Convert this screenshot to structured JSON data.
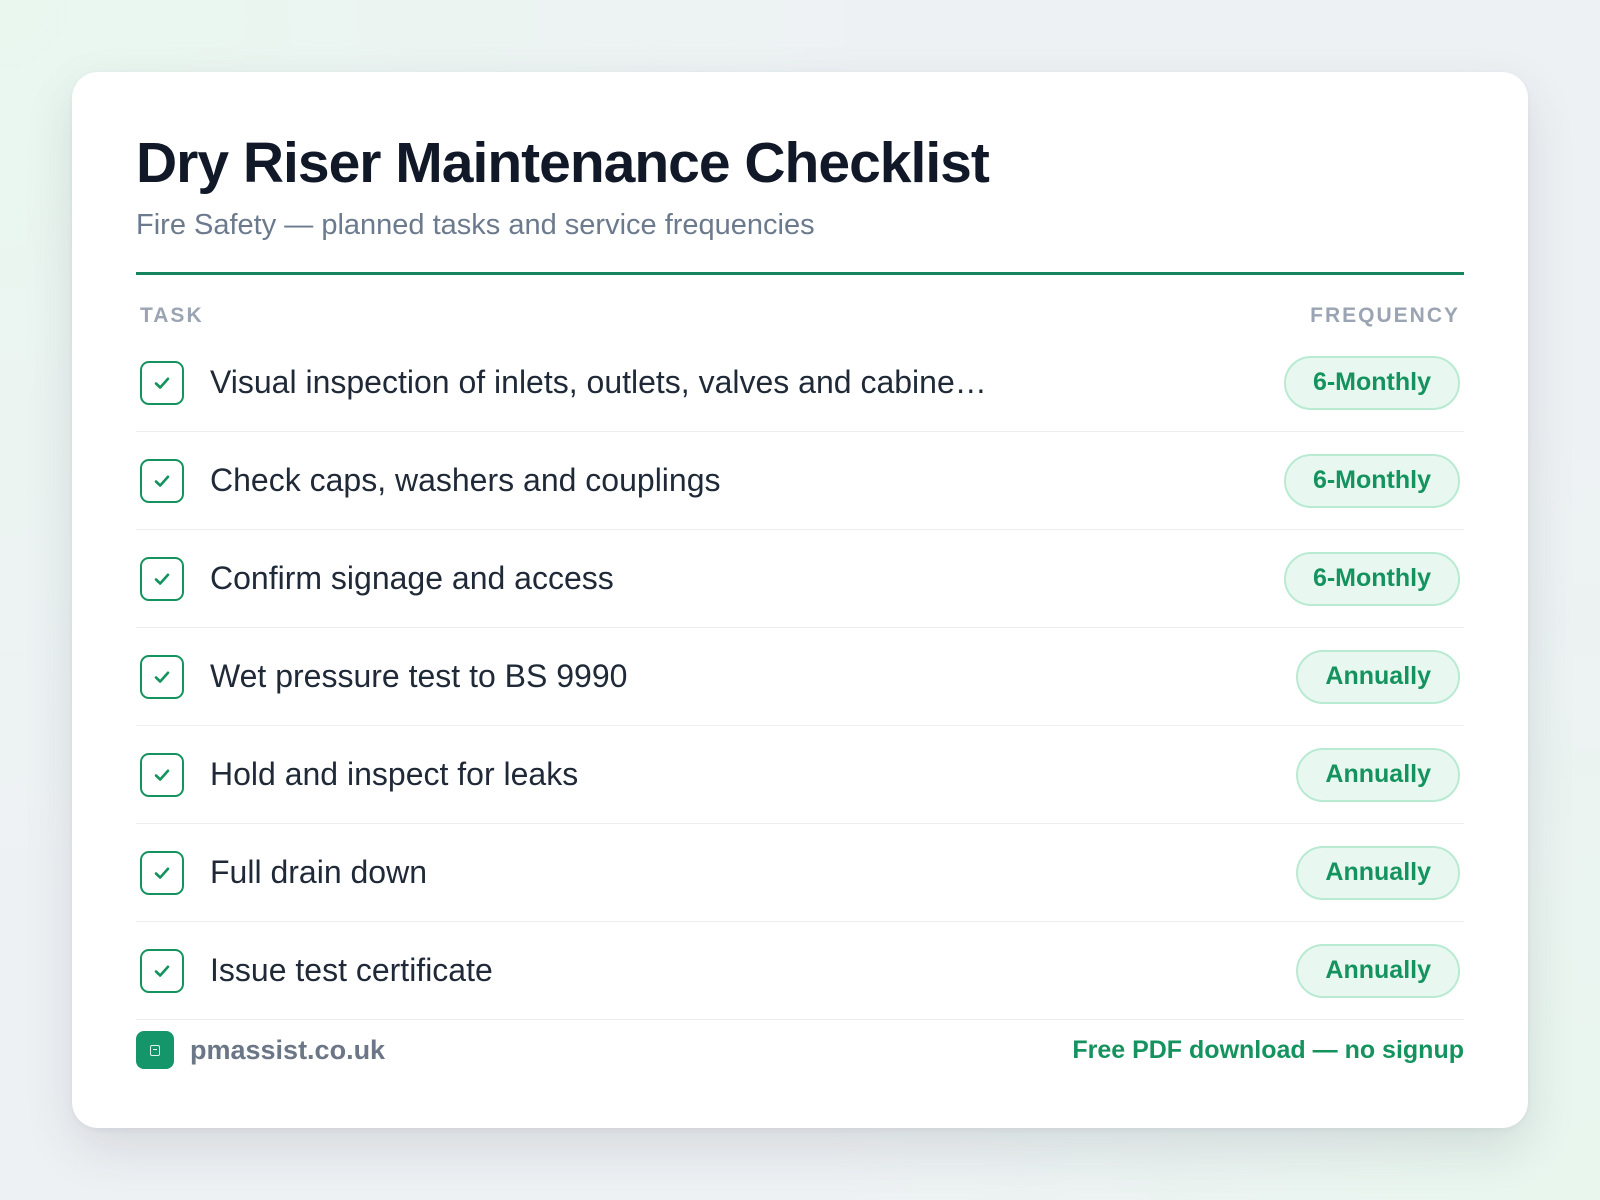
{
  "header": {
    "title": "Dry Riser Maintenance Checklist",
    "subtitle": "Fire Safety — planned tasks and service frequencies"
  },
  "columns": {
    "task": "TASK",
    "frequency": "FREQUENCY"
  },
  "tasks": [
    {
      "label": "Visual inspection of inlets, outlets, valves and cabine…",
      "frequency": "6-Monthly",
      "checked": true
    },
    {
      "label": "Check caps, washers and couplings",
      "frequency": "6-Monthly",
      "checked": true
    },
    {
      "label": "Confirm signage and access",
      "frequency": "6-Monthly",
      "checked": true
    },
    {
      "label": "Wet pressure test to BS 9990",
      "frequency": "Annually",
      "checked": true
    },
    {
      "label": "Hold and inspect for leaks",
      "frequency": "Annually",
      "checked": true
    },
    {
      "label": "Full drain down",
      "frequency": "Annually",
      "checked": true
    },
    {
      "label": "Issue test certificate",
      "frequency": "Annually",
      "checked": true
    }
  ],
  "footer": {
    "site": "pmassist.co.uk",
    "cta": "Free PDF download — no signup",
    "logo_icon": "clipboard-icon"
  },
  "icons": {
    "check": "check-icon"
  },
  "colors": {
    "accent": "#15935f",
    "rule": "#15855f",
    "badge_bg": "#e8f8f0",
    "badge_border": "#b9ead2",
    "title": "#111827",
    "muted": "#6b7a8c"
  }
}
